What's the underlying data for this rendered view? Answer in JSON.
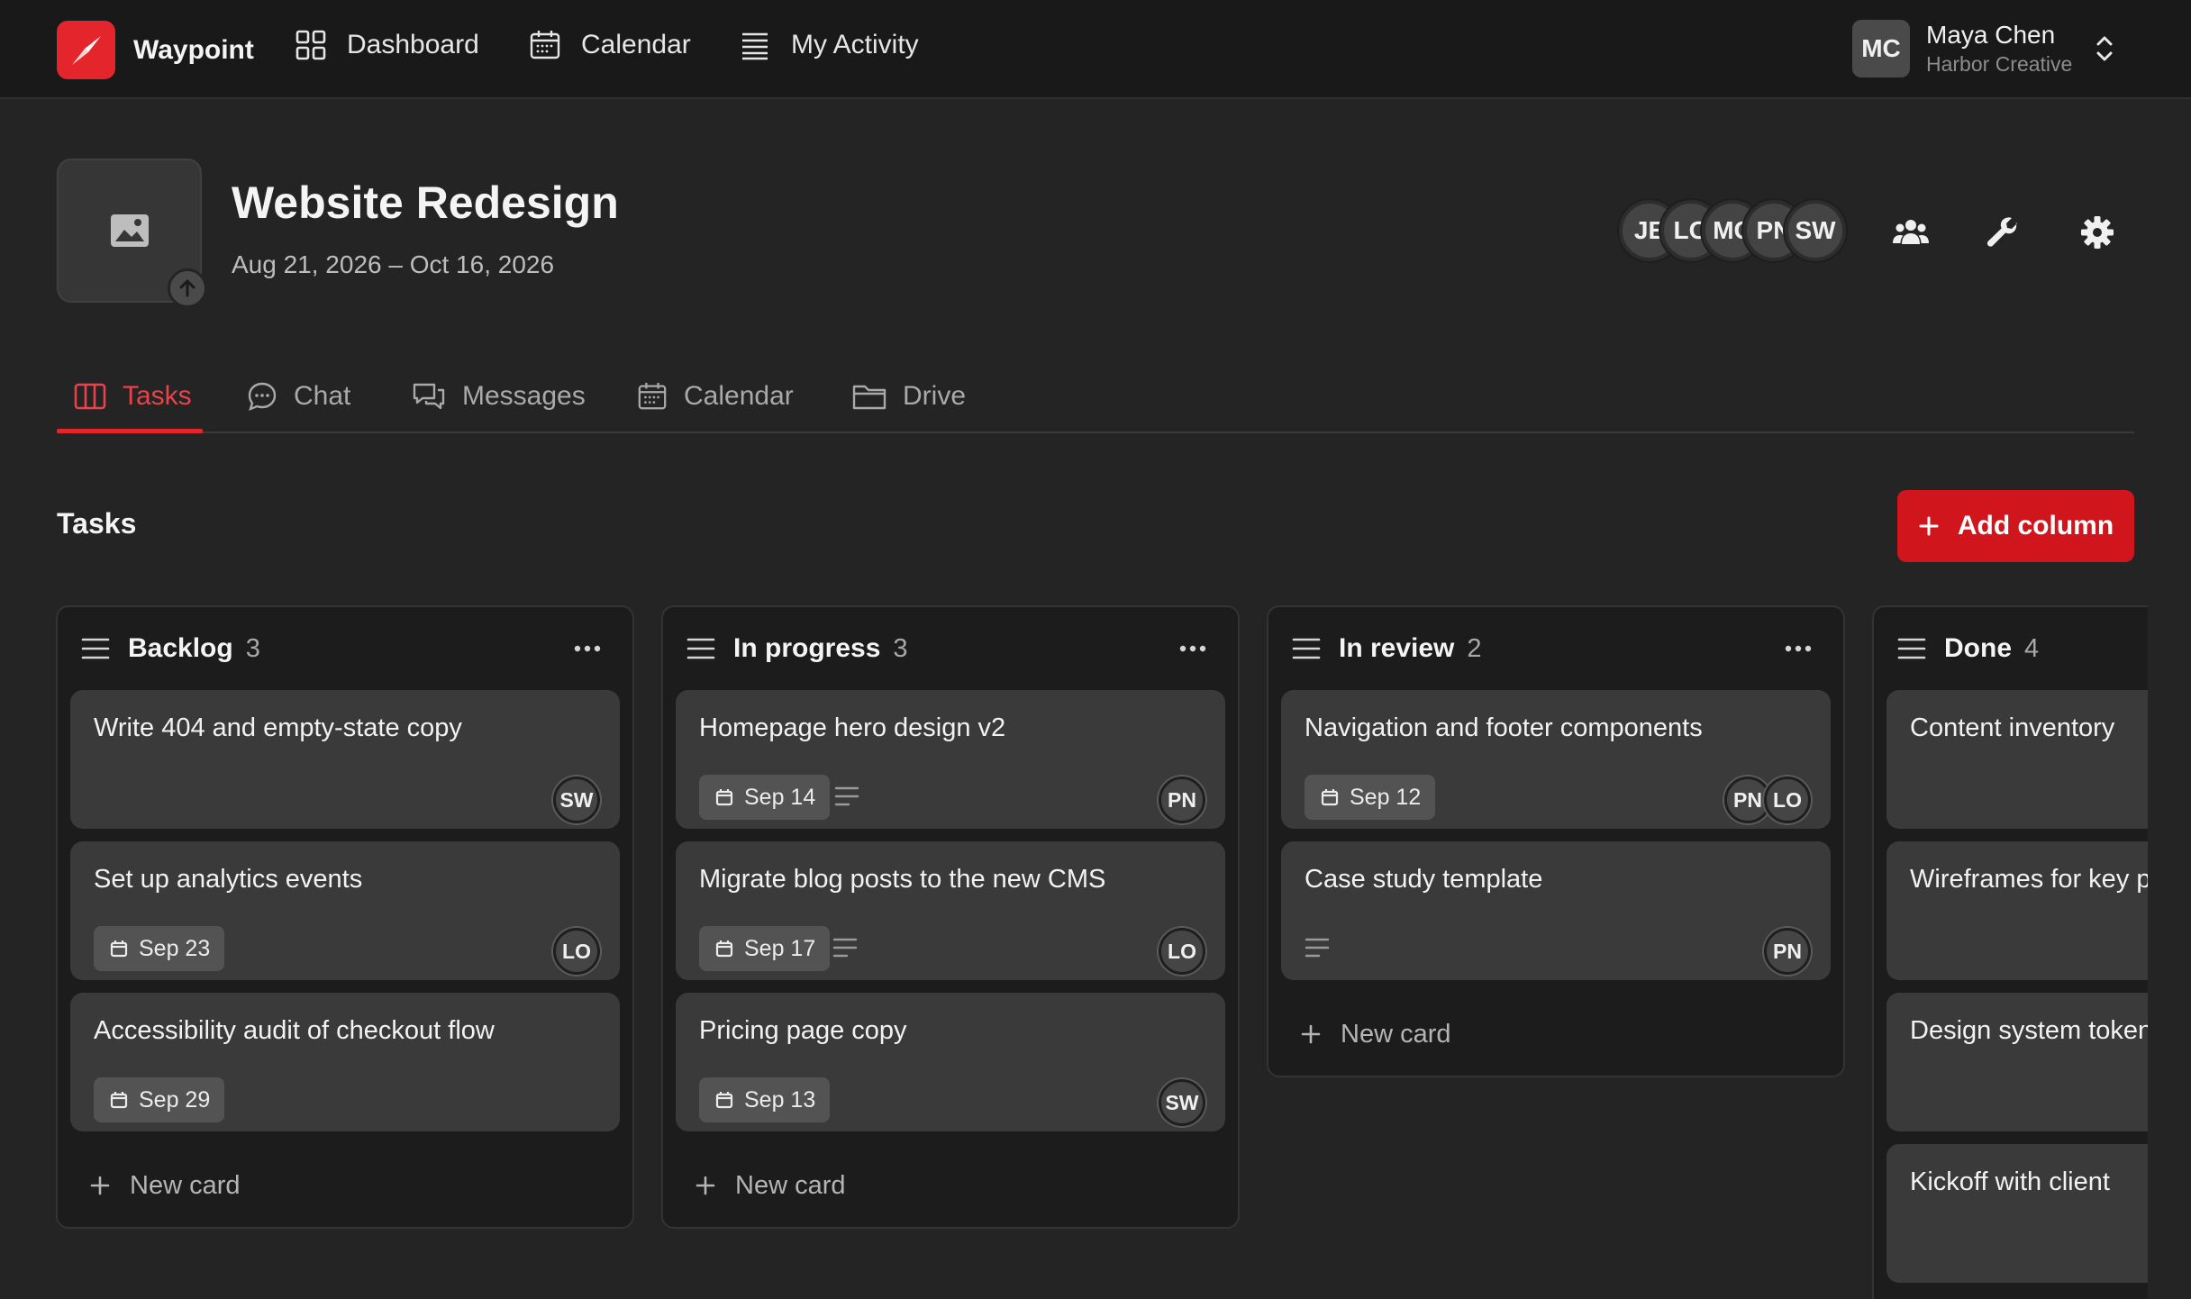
{
  "brand": {
    "name": "Waypoint",
    "color": "#e5252c",
    "icon": "compass-icon"
  },
  "nav": [
    {
      "label": "Dashboard",
      "icon": "grid-icon"
    },
    {
      "label": "Calendar",
      "icon": "calendar-icon"
    },
    {
      "label": "My Activity",
      "icon": "activity-list-icon"
    }
  ],
  "user": {
    "initials": "MC",
    "name": "Maya Chen",
    "org": "Harbor Creative"
  },
  "project": {
    "title": "Website Redesign",
    "dates": "Aug 21, 2026 – Oct 16, 2026",
    "members": [
      "JE",
      "LO",
      "MC",
      "PN",
      "SW"
    ]
  },
  "tabs": [
    {
      "label": "Tasks",
      "active": true
    },
    {
      "label": "Chat",
      "active": false
    },
    {
      "label": "Messages",
      "active": false
    },
    {
      "label": "Calendar",
      "active": false
    },
    {
      "label": "Drive",
      "active": false
    }
  ],
  "section": {
    "title": "Tasks",
    "add_column_label": "Add column"
  },
  "new_card_label": "New card",
  "columns": [
    {
      "name": "Backlog",
      "count": "3",
      "cards": [
        {
          "title": "Write 404 and empty-state copy",
          "due": "",
          "has_description": false,
          "assignees": [
            "SW"
          ]
        },
        {
          "title": "Set up analytics events",
          "due": "Sep 23",
          "has_description": false,
          "assignees": [
            "LO"
          ]
        },
        {
          "title": "Accessibility audit of checkout flow",
          "due": "Sep 29",
          "has_description": false,
          "assignees": []
        }
      ]
    },
    {
      "name": "In progress",
      "count": "3",
      "cards": [
        {
          "title": "Homepage hero design v2",
          "due": "Sep 14",
          "has_description": true,
          "assignees": [
            "PN"
          ]
        },
        {
          "title": "Migrate blog posts to the new CMS",
          "due": "Sep 17",
          "has_description": true,
          "assignees": [
            "LO"
          ]
        },
        {
          "title": "Pricing page copy",
          "due": "Sep 13",
          "has_description": false,
          "assignees": [
            "SW"
          ]
        }
      ]
    },
    {
      "name": "In review",
      "count": "2",
      "cards": [
        {
          "title": "Navigation and footer components",
          "due": "Sep 12",
          "has_description": false,
          "assignees": [
            "PN",
            "LO"
          ]
        },
        {
          "title": "Case study template",
          "due": "",
          "has_description": true,
          "assignees": [
            "PN"
          ]
        }
      ]
    },
    {
      "name": "Done",
      "count": "4",
      "cards": [
        {
          "title": "Content inventory",
          "due": "",
          "has_description": false,
          "assignees": []
        },
        {
          "title": "Wireframes for key pages",
          "due": "",
          "has_description": false,
          "assignees": []
        },
        {
          "title": "Design system tokens",
          "due": "",
          "has_description": false,
          "assignees": []
        },
        {
          "title": "Kickoff with client",
          "due": "",
          "has_description": false,
          "assignees": []
        }
      ]
    }
  ]
}
